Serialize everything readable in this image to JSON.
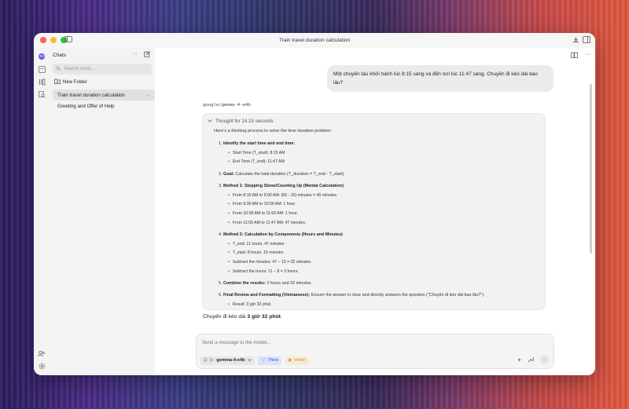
{
  "window": {
    "title": "Train travel duration calculation"
  },
  "colors": {
    "close": "#ff5f57",
    "minimize": "#febc2e",
    "zoom": "#28c840",
    "think_accent": "#3b5bd6",
    "vision_accent": "#c98a2e"
  },
  "sidebar": {
    "title": "Chats",
    "search_placeholder": "Search chats...",
    "new_folder_label": "New Folder",
    "chats": [
      {
        "label": "Train travel duration calculation",
        "active": true
      },
      {
        "label": "Greeting and Offer of Help",
        "active": false
      }
    ]
  },
  "conversation": {
    "user_message": "Một chuyến tàu khởi hành lúc 8:15 sáng và đến nơi lúc 11:47 sáng. Chuyến đi kéo dài bao lâu?",
    "model_name": "google/gemma-4-e4b",
    "thought_label": "Thought for 14.15 seconds",
    "thought_intro": "Here's a thinking process to solve the time duration problem:",
    "steps": [
      {
        "num": "1.",
        "bold": "Identify the start time and end time:",
        "rest": "",
        "bullets": [
          "Start Time (T_start): 8:15 AM",
          "End Time (T_end): 11:47 AM"
        ]
      },
      {
        "num": "2.",
        "bold": "Goal:",
        "rest": " Calculate the total duration (T_duration = T_end - T_start).",
        "bullets": []
      },
      {
        "num": "3.",
        "bold": "Method 1: Stepping Stone/Counting Up (Mental Calculation)",
        "rest": "",
        "bullets": [
          "From 8:15 AM to 9:00 AM: (60 - 15) minutes = 45 minutes.",
          "From 9:00 AM to 10:00 AM: 1 hour.",
          "From 10:00 AM to 11:00 AM: 1 hour.",
          "From 11:00 AM to 11:47 AM: 47 minutes."
        ]
      },
      {
        "num": "4.",
        "bold": "Method 2: Calculation by Components (Hours and Minutes)",
        "rest": "",
        "bullets": [
          "T_end: 11 hours, 47 minutes",
          "T_start: 8 hours, 15 minutes",
          "Subtract the minutes: 47 − 15 = 32 minutes.",
          "Subtract the hours: 11 − 8 = 3 hours."
        ]
      },
      {
        "num": "5.",
        "bold": "Combine the results:",
        "rest": " 3 hours and 32 minutes.",
        "bullets": []
      },
      {
        "num": "6.",
        "bold": "Final Review and Formatting (Vietnamese):",
        "rest": " Ensure the answer is clear and directly answers the question (\"Chuyến đi kéo dài bao lâu?\").",
        "bullets": [
          "Result: 3 giờ 32 phút."
        ]
      }
    ],
    "answer_prefix": "Chuyến đi kéo dài ",
    "answer_bold": "3 giờ 32 phút",
    "answer_suffix": "."
  },
  "composer": {
    "placeholder": "Send a message to the model...",
    "model_label": "gemma-4-e4b",
    "think_label": "Think",
    "vision_label": "Vision"
  }
}
